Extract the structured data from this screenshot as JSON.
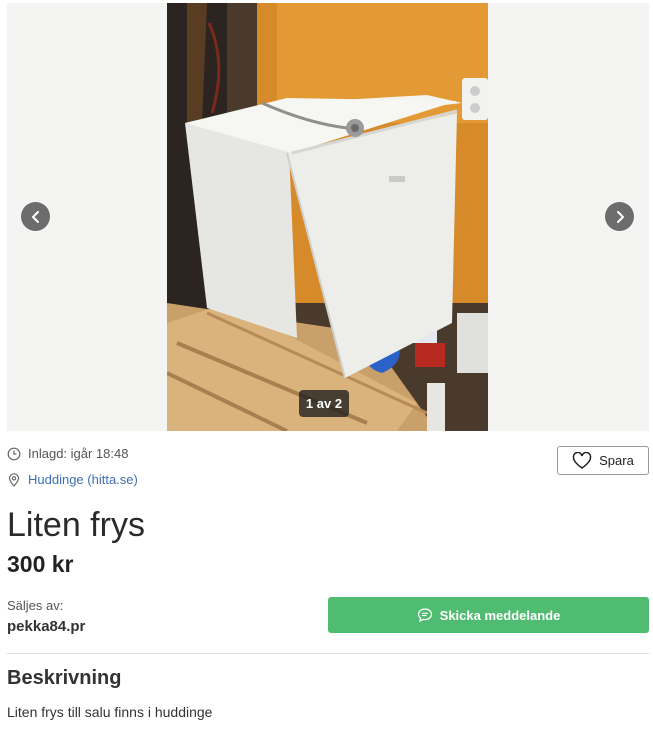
{
  "gallery": {
    "counter_text": "1 av 2",
    "current_image": 1,
    "total_images": 2
  },
  "listing": {
    "posted_label": "Inlagd: igår 18:48",
    "location_link": "Huddinge (hitta.se)",
    "save_label": "Spara",
    "title": "Liten frys",
    "price": "300 kr"
  },
  "seller": {
    "label": "Säljes av:",
    "name": "pekka84.pr",
    "message_button": "Skicka meddelande"
  },
  "description": {
    "heading": "Beskrivning",
    "text": "Liten frys till salu finns i huddinge"
  },
  "icons": {
    "prev": "chevron-left-icon",
    "next": "chevron-right-icon",
    "posted": "clock-icon",
    "location": "map-pin-icon",
    "save": "heart-icon",
    "message": "chat-bubble-icon"
  },
  "colors": {
    "message_button": "#4fbc72",
    "location_link": "#3f6fb0",
    "gallery_background": "#f4f4f3"
  }
}
